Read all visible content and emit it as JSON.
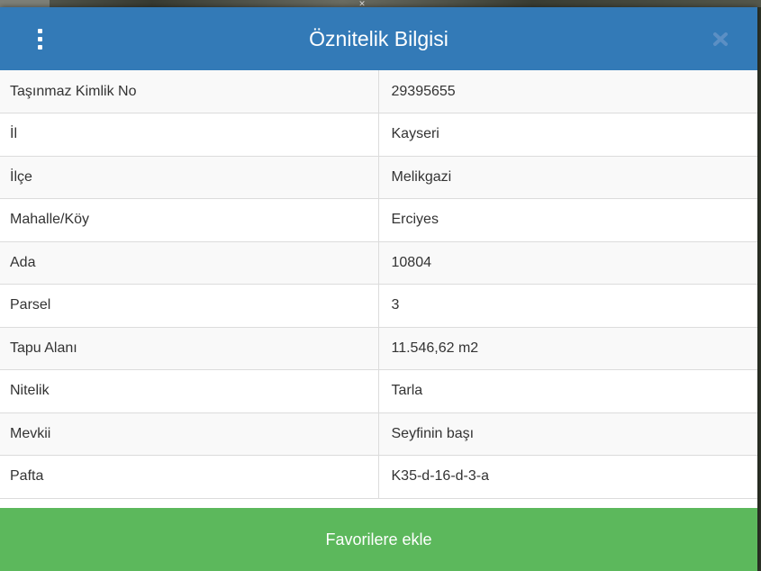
{
  "header": {
    "title": "Öznitelik Bilgisi",
    "menu_icon": "vertical-dots-icon",
    "close_icon": "close-icon",
    "background_color": "#337ab7"
  },
  "attributes": [
    {
      "key": "Taşınmaz Kimlik No",
      "value": "29395655"
    },
    {
      "key": "İl",
      "value": "Kayseri"
    },
    {
      "key": "İlçe",
      "value": "Melikgazi"
    },
    {
      "key": "Mahalle/Köy",
      "value": "Erciyes"
    },
    {
      "key": "Ada",
      "value": "10804"
    },
    {
      "key": "Parsel",
      "value": "3"
    },
    {
      "key": "Tapu Alanı",
      "value": "11.546,62 m2"
    },
    {
      "key": "Nitelik",
      "value": "Tarla"
    },
    {
      "key": "Mevkii",
      "value": "Seyfinin başı"
    },
    {
      "key": "Pafta",
      "value": "K35-d-16-d-3-a"
    }
  ],
  "footer": {
    "favorite_label": "Favorilere ekle",
    "button_color": "#5cb85c"
  }
}
